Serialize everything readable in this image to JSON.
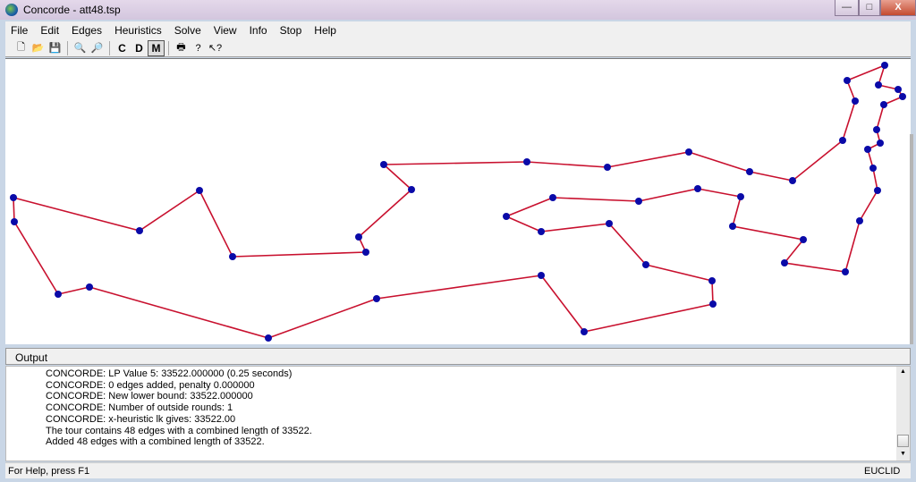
{
  "window": {
    "title": "Concorde - att48.tsp",
    "minimize": "—",
    "maximize": "□",
    "close": "X"
  },
  "menu": [
    "File",
    "Edit",
    "Edges",
    "Heuristics",
    "Solve",
    "View",
    "Info",
    "Stop",
    "Help"
  ],
  "toolbar": [
    {
      "icon": "new-file-icon",
      "glyph": "🗋"
    },
    {
      "icon": "open-folder-icon",
      "glyph": "📂"
    },
    {
      "icon": "save-icon",
      "glyph": "💾"
    },
    {
      "sep": true
    },
    {
      "icon": "zoom-in-icon",
      "glyph": "🔍"
    },
    {
      "icon": "zoom-out-icon",
      "glyph": "🔎"
    },
    {
      "sep": true
    },
    {
      "label": "C"
    },
    {
      "label": "D"
    },
    {
      "label": "M",
      "pressed": true
    },
    {
      "sep": true
    },
    {
      "icon": "print-icon",
      "glyph": "🖶"
    },
    {
      "icon": "help-icon",
      "glyph": "?"
    },
    {
      "icon": "context-help-icon",
      "glyph": "↖?"
    }
  ],
  "graph": {
    "edge_color": "#c8102e",
    "node_color": "#0a0aa8",
    "nodes": 48,
    "edges": 48
  },
  "output": {
    "title": "Output",
    "lines": [
      "CONCORDE:   LP Value  5: 33522.000000  (0.25 seconds)",
      "CONCORDE: 0 edges added, penalty 0.000000",
      "CONCORDE: New lower bound: 33522.000000",
      "CONCORDE: Number of outside rounds: 1",
      "CONCORDE: x-heuristic lk  gives: 33522.00",
      "The tour contains 48 edges with a combined length of 33522.",
      "Added 48 edges with a combined length of 33522."
    ]
  },
  "status": {
    "help": "For Help, press F1",
    "norm": "EUCLID"
  }
}
